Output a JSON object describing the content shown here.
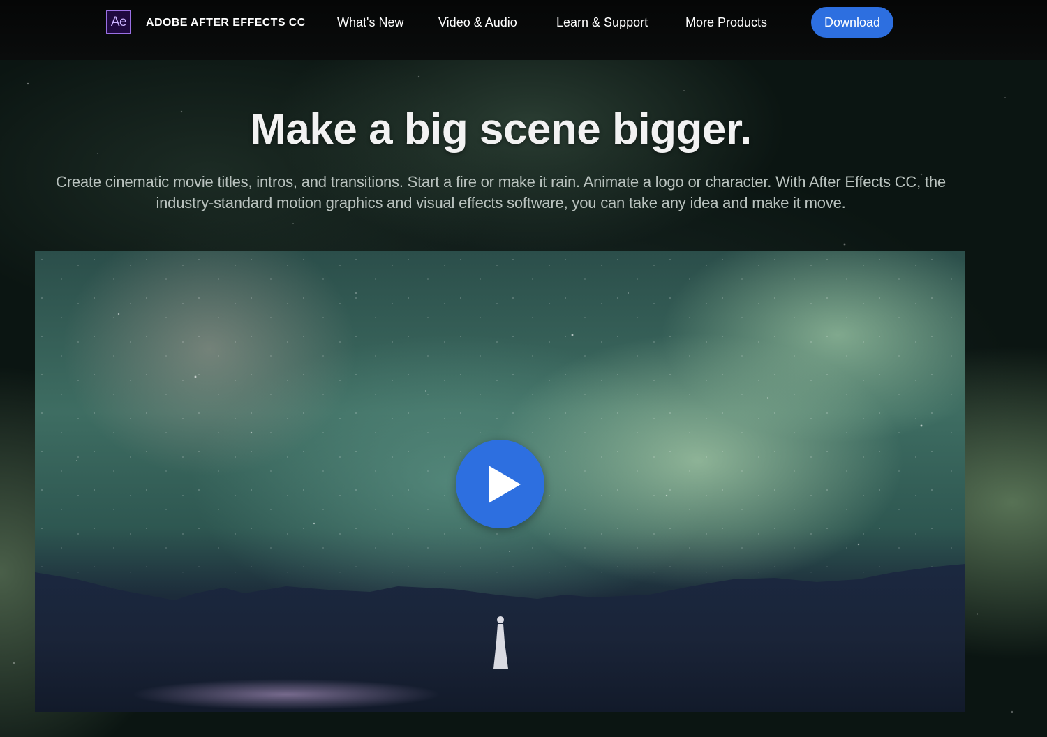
{
  "nav": {
    "logo_text": "Ae",
    "brand": "ADOBE AFTER EFFECTS CC",
    "links": [
      "What's New",
      "Video & Audio",
      "Learn & Support",
      "More Products"
    ],
    "download_label": "Download"
  },
  "hero": {
    "headline": "Make a big scene bigger.",
    "subtext": "Create cinematic movie titles, intros, and transitions. Start a fire or make it rain. Animate a logo or character. With After Effects CC, the industry-standard motion graphics and visual effects software, you can take any idea and make it move."
  },
  "video": {
    "play_icon": "play-icon"
  },
  "colors": {
    "accent_blue": "#2d6fe0",
    "nav_bg": "#050606",
    "logo_purple": "#9a70e4",
    "logo_bg": "#1f0940"
  }
}
